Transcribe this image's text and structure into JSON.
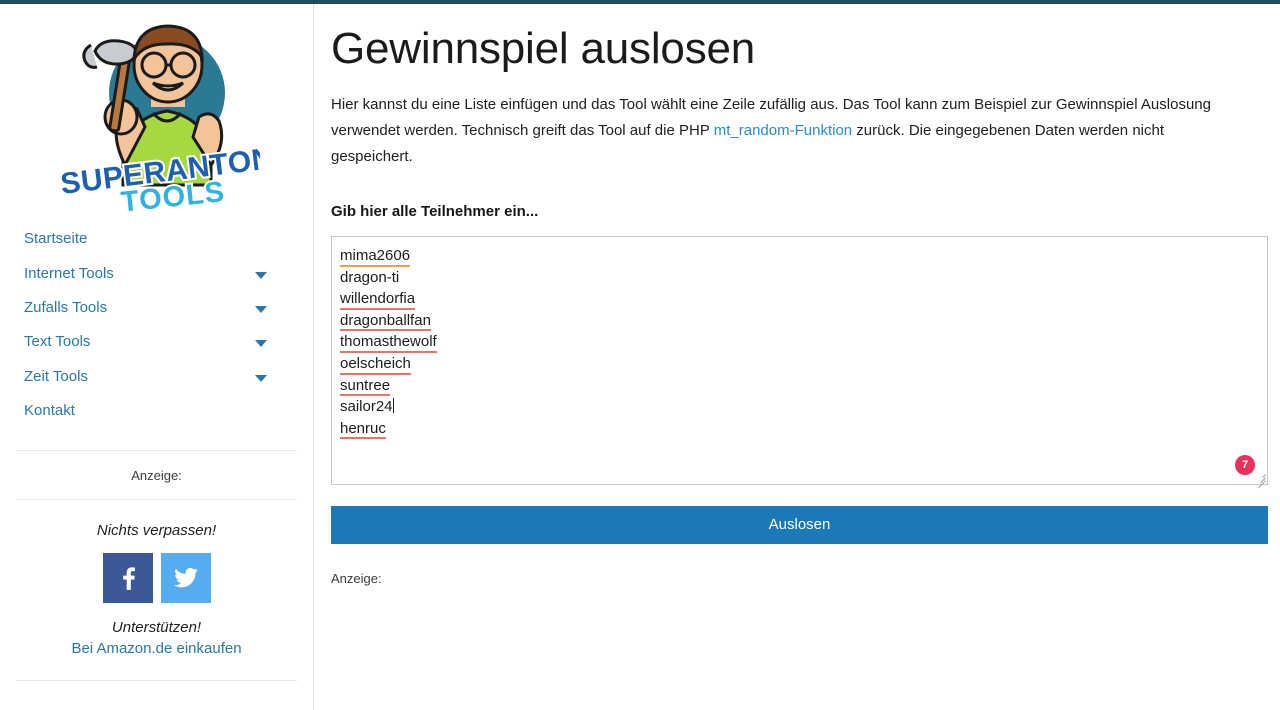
{
  "theme": {
    "top_bar_color": "#1d4f63",
    "link_color": "#2a77ab",
    "accent_link_color": "#2a8bd0",
    "button_color": "#1b79b8",
    "badge_color": "#e8305c",
    "facebook_color": "#3b5998",
    "twitter_color": "#55acee",
    "spell_error_color": "#e8736a",
    "grammar_warn_color": "#e8a33d"
  },
  "sidebar": {
    "logo": {
      "name": "superanton-tools-logo",
      "word_top": "SUPERANTON",
      "word_bottom": "TOOLS"
    },
    "nav": [
      {
        "label": "Startseite",
        "has_caret": false,
        "icon": ""
      },
      {
        "label": "Internet Tools",
        "has_caret": true,
        "icon": "chevron-down-icon"
      },
      {
        "label": "Zufalls Tools",
        "has_caret": true,
        "icon": "chevron-down-icon"
      },
      {
        "label": "Text Tools",
        "has_caret": true,
        "icon": "chevron-down-icon"
      },
      {
        "label": "Zeit Tools",
        "has_caret": true,
        "icon": "chevron-down-icon"
      },
      {
        "label": "Kontakt",
        "has_caret": false,
        "icon": ""
      }
    ],
    "ad_label": "Anzeige:",
    "promo": {
      "title": "Nichts verpassen!",
      "facebook_icon": "facebook-icon",
      "twitter_icon": "twitter-icon"
    },
    "support": {
      "title": "Unterstützen!",
      "link_label": "Bei Amazon.de einkaufen"
    }
  },
  "main": {
    "title": "Gewinnspiel auslosen",
    "intro": {
      "part1": "Hier kannst du eine Liste einfügen und das Tool wählt eine Zeile zufällig aus. Das Tool kann zum Beispiel zur Gewinnspiel Auslosung verwendet werden. Technisch greift das Tool auf die PHP ",
      "link": "mt_random-Funktion",
      "part2": " zurück. Die eingegebenen Daten werden nicht gespeichert."
    },
    "field_label": "Gib hier alle Teilnehmer ein...",
    "textarea": {
      "placeholder": "",
      "value": "mima2606\ndragon-ti\nwillendorfia\ndragonballfan\nthomasthewolf\noelscheich\nsuntree\nsailor24\nhenruc",
      "lines": [
        {
          "text": "mima2606",
          "underline": "warn",
          "caret": false
        },
        {
          "text": "dragon-ti",
          "underline": "none",
          "caret": false
        },
        {
          "text": "willendorfia",
          "underline": "err",
          "caret": false
        },
        {
          "text": "dragonballfan",
          "underline": "err",
          "caret": false
        },
        {
          "text": "thomasthewolf",
          "underline": "err",
          "caret": false
        },
        {
          "text": "oelscheich",
          "underline": "err",
          "caret": false
        },
        {
          "text": "suntree",
          "underline": "err",
          "caret": false
        },
        {
          "text": "sailor24",
          "underline": "none",
          "caret": true
        },
        {
          "text": "henruc",
          "underline": "err",
          "caret": false
        }
      ],
      "grammar_badge": {
        "icon": "grammar-check-icon",
        "count": "7"
      },
      "resize_handle_icon": "resize-grip-icon"
    },
    "submit_label": "Auslosen",
    "ad_label": "Anzeige:"
  }
}
